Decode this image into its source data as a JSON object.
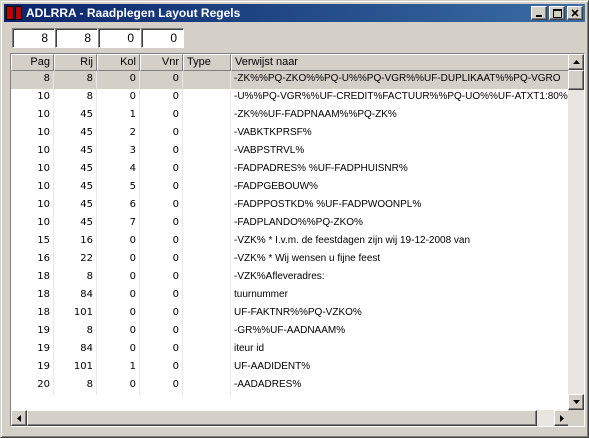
{
  "window": {
    "title": "ADLRRA - Raadplegen Layout Regels",
    "minimize_icon": "minimize-icon",
    "maximize_icon": "maximize-icon",
    "close_icon": "close-icon"
  },
  "filters": [
    "8",
    "8",
    "0",
    "0"
  ],
  "columns": {
    "pag": "Pag",
    "rij": "Rij",
    "kol": "Kol",
    "vnr": "Vnr",
    "type": "Type",
    "ref": "Verwijst naar"
  },
  "rows": [
    {
      "pag": "8",
      "rij": "8",
      "kol": "0",
      "vnr": "0",
      "type": "",
      "ref": "-ZK%%PQ-ZKO%%PQ-U%%PQ-VGR%%UF-DUPLIKAAT%%PQ-VGRO"
    },
    {
      "pag": "10",
      "rij": "8",
      "kol": "0",
      "vnr": "0",
      "type": "",
      "ref": "-U%%PQ-VGR%%UF-CREDIT%FACTUUR%%PQ-UO%%UF-ATXT1:80%"
    },
    {
      "pag": "10",
      "rij": "45",
      "kol": "1",
      "vnr": "0",
      "type": "",
      "ref": "-ZK%%UF-FADPNAAM%%PQ-ZK%"
    },
    {
      "pag": "10",
      "rij": "45",
      "kol": "2",
      "vnr": "0",
      "type": "",
      "ref": "-VABKTKPRSF%"
    },
    {
      "pag": "10",
      "rij": "45",
      "kol": "3",
      "vnr": "0",
      "type": "",
      "ref": "-VABPSTRVL%"
    },
    {
      "pag": "10",
      "rij": "45",
      "kol": "4",
      "vnr": "0",
      "type": "",
      "ref": "-FADPADRES% %UF-FADPHUISNR%"
    },
    {
      "pag": "10",
      "rij": "45",
      "kol": "5",
      "vnr": "0",
      "type": "",
      "ref": "-FADPGEBOUW%"
    },
    {
      "pag": "10",
      "rij": "45",
      "kol": "6",
      "vnr": "0",
      "type": "",
      "ref": "-FADPPOSTKD% %UF-FADPWOONPL%"
    },
    {
      "pag": "10",
      "rij": "45",
      "kol": "7",
      "vnr": "0",
      "type": "",
      "ref": "-FADPLANDO%%PQ-ZKO%"
    },
    {
      "pag": "15",
      "rij": "16",
      "kol": "0",
      "vnr": "0",
      "type": "",
      "ref": "-VZK% * I.v.m. de feestdagen zijn wij 19-12-2008 van"
    },
    {
      "pag": "16",
      "rij": "22",
      "kol": "0",
      "vnr": "0",
      "type": "",
      "ref": "-VZK%                    * Wij wensen u fijne feest"
    },
    {
      "pag": "18",
      "rij": "8",
      "kol": "0",
      "vnr": "0",
      "type": "",
      "ref": "-VZK%Afleveradres:"
    },
    {
      "pag": "18",
      "rij": "84",
      "kol": "0",
      "vnr": "0",
      "type": "",
      "ref": "tuurnummer"
    },
    {
      "pag": "18",
      "rij": "101",
      "kol": "0",
      "vnr": "0",
      "type": "",
      "ref": "UF-FAKTNR%%PQ-VZKO%"
    },
    {
      "pag": "19",
      "rij": "8",
      "kol": "0",
      "vnr": "0",
      "type": "",
      "ref": "-GR%%UF-AADNAAM%"
    },
    {
      "pag": "19",
      "rij": "84",
      "kol": "0",
      "vnr": "0",
      "type": "",
      "ref": "iteur id"
    },
    {
      "pag": "19",
      "rij": "101",
      "kol": "1",
      "vnr": "0",
      "type": "",
      "ref": "UF-AADIDENT%"
    },
    {
      "pag": "20",
      "rij": "8",
      "kol": "0",
      "vnr": "0",
      "type": "",
      "ref": "-AADADRES%"
    }
  ],
  "colors": {
    "title_start": "#0a246a",
    "title_end": "#3a6ea5",
    "face": "#d4d0c8"
  }
}
